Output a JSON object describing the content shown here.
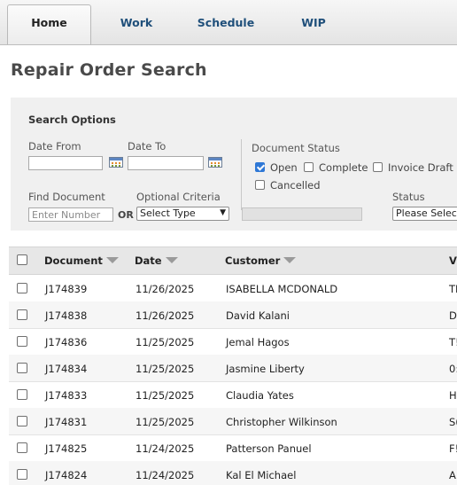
{
  "tabs": [
    {
      "label": "Home",
      "active": true
    },
    {
      "label": "Work"
    },
    {
      "label": "Schedule"
    },
    {
      "label": "WIP"
    }
  ],
  "page_title": "Repair Order Search",
  "search_options": {
    "title": "Search Options",
    "date_from_label": "Date From",
    "date_to_label": "Date To",
    "date_from_value": "",
    "date_to_value": "",
    "document_status_label": "Document Status",
    "statuses": [
      {
        "label": "Open",
        "checked": true
      },
      {
        "label": "Complete",
        "checked": false
      },
      {
        "label": "Invoice Draft",
        "checked": false
      },
      {
        "label": "Cancelled",
        "checked": false
      }
    ],
    "find_document_label": "Find Document",
    "find_document_placeholder": "Enter Number",
    "or_label": "OR",
    "optional_criteria_label": "Optional Criteria",
    "optional_criteria_value": "Select Type",
    "status_label": "Status",
    "status_value": "Please Select"
  },
  "table": {
    "columns": [
      "Document",
      "Date",
      "Customer",
      "V"
    ],
    "rows": [
      {
        "document": "J174839",
        "date": "11/26/2025",
        "customer": "ISABELLA MCDONALD",
        "v": "TI"
      },
      {
        "document": "J174838",
        "date": "11/26/2025",
        "customer": "David Kalani",
        "v": "D"
      },
      {
        "document": "J174836",
        "date": "11/25/2025",
        "customer": "Jemal Hagos",
        "v": "T!"
      },
      {
        "document": "J174834",
        "date": "11/25/2025",
        "customer": "Jasmine Liberty",
        "v": "0:"
      },
      {
        "document": "J174833",
        "date": "11/25/2025",
        "customer": "Claudia Yates",
        "v": "H"
      },
      {
        "document": "J174831",
        "date": "11/25/2025",
        "customer": "Christopher Wilkinson",
        "v": "S("
      },
      {
        "document": "J174825",
        "date": "11/24/2025",
        "customer": "Patterson Panuel",
        "v": "F!"
      },
      {
        "document": "J174824",
        "date": "11/24/2025",
        "customer": "Kal El Michael",
        "v": "A'"
      }
    ]
  }
}
